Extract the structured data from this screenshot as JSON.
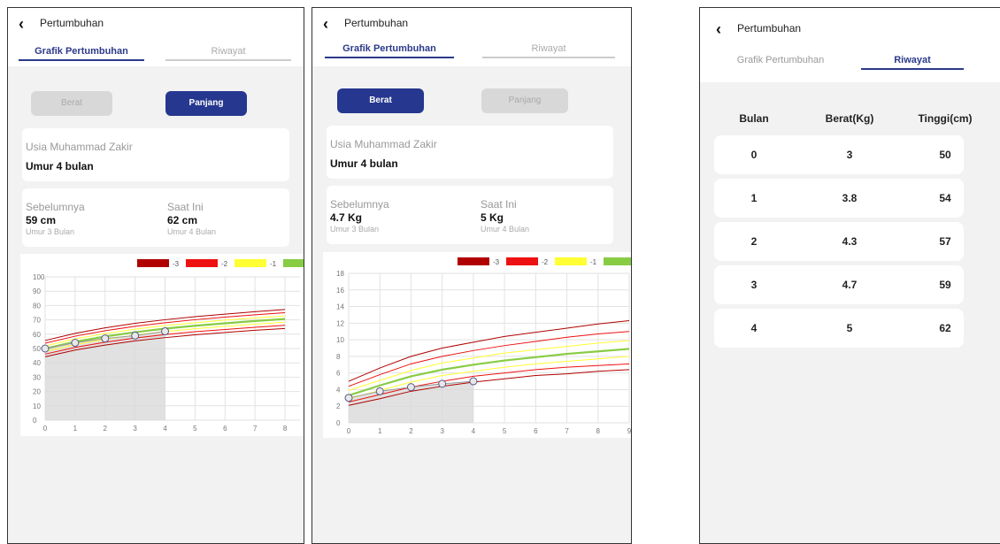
{
  "app": {
    "title": "Pertumbuhan",
    "back_icon": "chevron-left-icon"
  },
  "tabs": {
    "grafik": "Grafik Pertumbuhan",
    "riwayat": "Riwayat"
  },
  "toggle": {
    "berat": "Berat",
    "panjang": "Panjang"
  },
  "child": {
    "name_label": "Usia Muhammad Zakir",
    "age": "Umur 4 bulan"
  },
  "panjang": {
    "prev_label": "Sebelumnya",
    "prev_value": "59 cm",
    "prev_age": "Umur 3 Bulan",
    "curr_label": "Saat Ini",
    "curr_value": "62 cm",
    "curr_age": "Umur 4 Bulan"
  },
  "berat": {
    "prev_label": "Sebelumnya",
    "prev_value": "4.7 Kg",
    "prev_age": "Umur 3 Bulan",
    "curr_label": "Saat Ini",
    "curr_value": "5 Kg",
    "curr_age": "Umur 4 Bulan"
  },
  "legend": [
    {
      "label": "-3",
      "color": "#b00000"
    },
    {
      "label": "-2",
      "color": "#ee1111"
    },
    {
      "label": "-1",
      "color": "#ffff33"
    },
    {
      "label": "",
      "color": "#88cc44"
    }
  ],
  "chart_data": [
    {
      "type": "line",
      "x_ticks": [
        0,
        1,
        2,
        3,
        4,
        5,
        6,
        7,
        8
      ],
      "y_ticks": [
        0,
        10,
        20,
        30,
        40,
        50,
        60,
        70,
        80,
        90,
        100
      ],
      "xlim": [
        0,
        8.5
      ],
      "ylim": [
        0,
        100
      ],
      "grid": true,
      "series": [
        {
          "values": [
            44.2,
            48.9,
            52.4,
            55.3,
            57.6,
            59.6,
            61.2,
            62.7,
            64.0
          ],
          "color": "#b00000"
        },
        {
          "values": [
            46.1,
            50.8,
            54.4,
            57.3,
            59.7,
            61.7,
            63.3,
            64.8,
            66.2
          ],
          "color": "#ee1111"
        },
        {
          "values": [
            48.0,
            52.8,
            56.4,
            59.4,
            61.8,
            63.8,
            65.5,
            67.0,
            68.4
          ],
          "color": "#ffff33"
        },
        {
          "values": [
            49.9,
            54.7,
            58.4,
            61.4,
            63.9,
            65.9,
            67.6,
            69.2,
            70.6
          ],
          "color": "#88cc44"
        },
        {
          "values": [
            51.8,
            56.7,
            60.4,
            63.5,
            66.0,
            68.0,
            69.8,
            71.3,
            72.8
          ],
          "color": "#ffff33"
        },
        {
          "values": [
            53.7,
            58.6,
            62.4,
            65.5,
            68.0,
            70.1,
            71.9,
            73.5,
            75.0
          ],
          "color": "#ee1111"
        },
        {
          "values": [
            55.6,
            60.6,
            64.4,
            67.6,
            70.1,
            72.2,
            74.0,
            75.7,
            77.2
          ],
          "color": "#b00000"
        }
      ],
      "child_points": {
        "x": [
          0,
          1,
          2,
          3,
          4
        ],
        "y": [
          50,
          54,
          57,
          59,
          62
        ]
      }
    },
    {
      "type": "line",
      "x_ticks": [
        0,
        1,
        2,
        3,
        4,
        5,
        6,
        7,
        8,
        9
      ],
      "y_ticks": [
        0,
        2,
        4,
        6,
        8,
        10,
        12,
        14,
        16,
        18
      ],
      "xlim": [
        0,
        9
      ],
      "ylim": [
        0,
        18
      ],
      "grid": true,
      "series": [
        {
          "values": [
            2.1,
            2.9,
            3.8,
            4.4,
            4.9,
            5.3,
            5.7,
            5.9,
            6.2,
            6.4
          ],
          "color": "#b00000"
        },
        {
          "values": [
            2.5,
            3.4,
            4.3,
            5.0,
            5.6,
            6.0,
            6.4,
            6.7,
            6.9,
            7.1
          ],
          "color": "#ee1111"
        },
        {
          "values": [
            2.9,
            3.9,
            4.9,
            5.7,
            6.2,
            6.7,
            7.1,
            7.4,
            7.7,
            8.0
          ],
          "color": "#ffff33"
        },
        {
          "values": [
            3.3,
            4.5,
            5.6,
            6.4,
            7.0,
            7.5,
            7.9,
            8.3,
            8.6,
            8.9
          ],
          "color": "#88cc44"
        },
        {
          "values": [
            3.9,
            5.1,
            6.3,
            7.2,
            7.8,
            8.4,
            8.8,
            9.2,
            9.6,
            9.9
          ],
          "color": "#ffff33"
        },
        {
          "values": [
            4.4,
            5.8,
            7.1,
            8.0,
            8.7,
            9.3,
            9.8,
            10.3,
            10.7,
            11.0
          ],
          "color": "#ee1111"
        },
        {
          "values": [
            5.0,
            6.6,
            8.0,
            9.0,
            9.7,
            10.4,
            10.9,
            11.4,
            11.9,
            12.3
          ],
          "color": "#b00000"
        }
      ],
      "child_points": {
        "x": [
          0,
          1,
          2,
          3,
          4
        ],
        "y": [
          3,
          3.8,
          4.3,
          4.7,
          5
        ]
      }
    }
  ],
  "riwayat": {
    "headers": [
      "Bulan",
      "Berat(Kg)",
      "Tinggi(cm)"
    ],
    "rows": [
      [
        "0",
        "3",
        "50"
      ],
      [
        "1",
        "3.8",
        "54"
      ],
      [
        "2",
        "4.3",
        "57"
      ],
      [
        "3",
        "4.7",
        "59"
      ],
      [
        "4",
        "5",
        "62"
      ]
    ]
  }
}
